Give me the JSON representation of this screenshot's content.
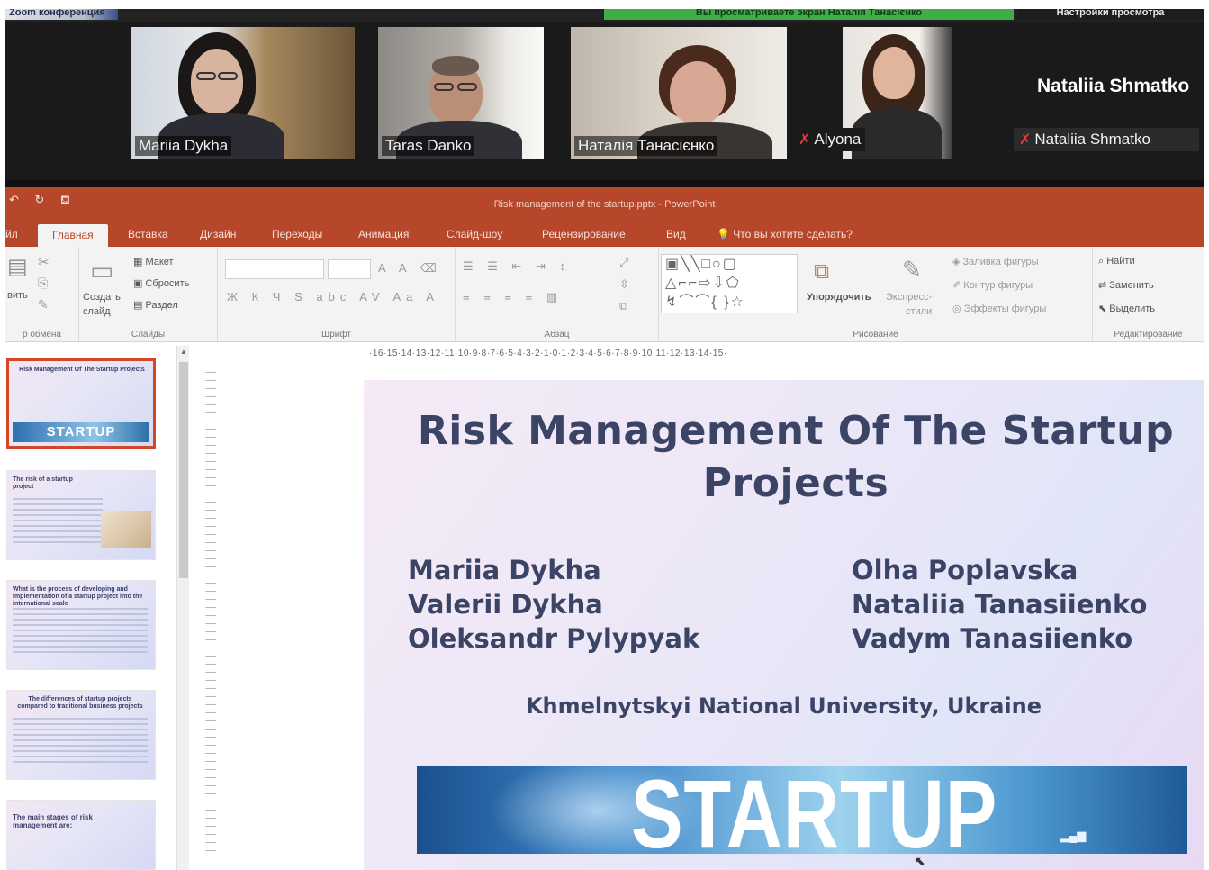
{
  "zoom": {
    "app_label": "Zoom конференция",
    "viewing_banner": "Вы просматриваете экран Наталія Танасієнко",
    "view_options": "Настройки просмотра",
    "participants": [
      {
        "name": "Mariia Dykha",
        "muted": false
      },
      {
        "name": "Taras Danko",
        "muted": false
      },
      {
        "name": "Наталія Танасієнко",
        "muted": false,
        "active": true
      },
      {
        "name": "Alyona",
        "muted": true
      }
    ],
    "self": {
      "name_large": "Nataliia Shmatko",
      "name_small": "Nataliia Shmatko",
      "muted": true
    },
    "icons": {
      "mic_off": "mic-off-icon"
    }
  },
  "powerpoint": {
    "doc_title": "Risk management of the startup.pptx  -  PowerPoint",
    "quick_access": [
      "↶",
      "↻",
      "⛾"
    ],
    "tabs": [
      "Главная",
      "Вставка",
      "Дизайн",
      "Переходы",
      "Анимация",
      "Слайд-шоу",
      "Рецензирование",
      "Вид"
    ],
    "tab_partial": "йл",
    "tell_me": "Что вы хотите сделать?",
    "active_tab": "Главная",
    "ribbon": {
      "clipboard": {
        "paste": "вить",
        "label": "р обмена"
      },
      "slides": {
        "new_slide": "Создать",
        "new_slide_2": "слайд",
        "layout": "Макет",
        "reset": "Сбросить",
        "section": "Раздел",
        "label": "Слайды"
      },
      "font": {
        "label": "Шрифт"
      },
      "paragraph": {
        "label": "Абзац"
      },
      "drawing": {
        "arrange": "Упорядочить",
        "quick_styles": "Экспресс-",
        "quick_styles_2": "стили",
        "fill": "Заливка фигуры",
        "outline": "Контур фигуры",
        "effects": "Эффекты фигуры",
        "label": "Рисование"
      },
      "editing": {
        "find": "Найти",
        "replace": "Заменить",
        "select": "Выделить",
        "label": "Редактирование"
      }
    },
    "ruler": "·16·15·14·13·12·11·10·9·8·7·6·5·4·3·2·1·0·1·2·3·4·5·6·7·8·9·10·11·12·13·14·15·",
    "thumbnails": [
      {
        "title": "Risk Management Of The Startup Projects",
        "banner": "STARTUP",
        "selected": true
      },
      {
        "title": "The risk of a startup project"
      },
      {
        "title": "What is the process of developing and implementation of a startup project into the international scale"
      },
      {
        "title": "The differences of startup projects compared to traditional business projects"
      },
      {
        "title": "The main stages of risk management are:"
      }
    ]
  },
  "slide": {
    "title_line1": "Risk Management Of The Startup",
    "title_line2": "Projects",
    "authors_left": [
      "Mariia Dykha",
      "Valerii Dykha",
      "Oleksandr Pylypyak"
    ],
    "authors_right": [
      "Olha Poplavska",
      "Nataliia Tanasiienko",
      "Vadym Tanasiienko"
    ],
    "university": "Khmelnytskyi National University, Ukraine",
    "banner_word": "STARTUP"
  },
  "colors": {
    "ppt_accent": "#b7472a",
    "zoom_green": "#3fae49",
    "slide_text": "#3c4466"
  }
}
